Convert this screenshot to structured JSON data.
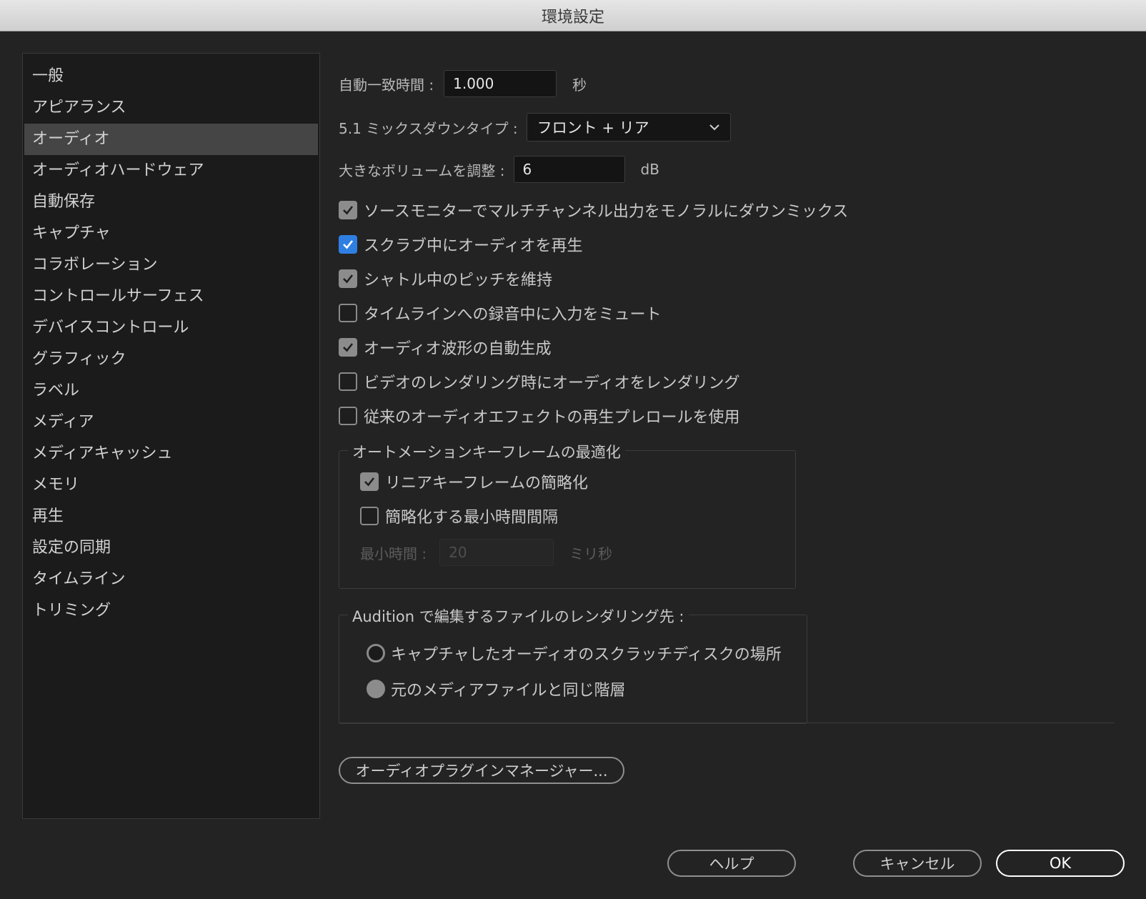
{
  "window": {
    "title": "環境設定"
  },
  "sidebar": {
    "items": [
      {
        "label": "一般"
      },
      {
        "label": "アピアランス"
      },
      {
        "label": "オーディオ",
        "selected": true
      },
      {
        "label": "オーディオハードウェア"
      },
      {
        "label": "自動保存"
      },
      {
        "label": "キャプチャ"
      },
      {
        "label": "コラボレーション"
      },
      {
        "label": "コントロールサーフェス"
      },
      {
        "label": "デバイスコントロール"
      },
      {
        "label": "グラフィック"
      },
      {
        "label": "ラベル"
      },
      {
        "label": "メディア"
      },
      {
        "label": "メディアキャッシュ"
      },
      {
        "label": "メモリ"
      },
      {
        "label": "再生"
      },
      {
        "label": "設定の同期"
      },
      {
        "label": "タイムライン"
      },
      {
        "label": "トリミング"
      }
    ]
  },
  "audio": {
    "auto_match": {
      "label": "自動一致時間 :",
      "value": "1.000",
      "unit": "秒"
    },
    "mixdown": {
      "label": "5.1 ミックスダウンタイプ :",
      "value": "フロント + リア"
    },
    "volume": {
      "label": "大きなボリュームを調整 :",
      "value": "6",
      "unit": "dB"
    },
    "checkboxes": [
      {
        "label": "ソースモニターでマルチチャンネル出力をモノラルにダウンミックス",
        "checked": true
      },
      {
        "label": "スクラブ中にオーディオを再生",
        "checked": true
      },
      {
        "label": "シャトル中のピッチを維持",
        "checked": true
      },
      {
        "label": "タイムラインへの録音中に入力をミュート",
        "checked": false
      },
      {
        "label": "オーディオ波形の自動生成",
        "checked": true
      },
      {
        "label": "ビデオのレンダリング時にオーディオをレンダリング",
        "checked": false
      },
      {
        "label": "従来のオーディオエフェクトの再生プレロールを使用",
        "checked": false
      }
    ],
    "automation": {
      "title": "オートメーションキーフレームの最適化",
      "linear": {
        "label": "リニアキーフレームの簡略化",
        "checked": true
      },
      "min_interval": {
        "label": "簡略化する最小時間間隔",
        "checked": false
      },
      "min_time": {
        "label": "最小時間 :",
        "value": "20",
        "unit": "ミリ秒"
      }
    },
    "audition": {
      "title": "Audition で編集するファイルのレンダリング先 :",
      "options": [
        {
          "label": "キャプチャしたオーディオのスクラッチディスクの場所",
          "selected": false
        },
        {
          "label": "元のメディアファイルと同じ階層",
          "selected": true
        }
      ]
    },
    "plugin_manager_label": "オーディオプラグインマネージャー..."
  },
  "footer": {
    "help": "ヘルプ",
    "cancel": "キャンセル",
    "ok": "OK"
  },
  "colors": {
    "accent": "#2f7fe3",
    "selection": "#454545",
    "background": "#232323"
  }
}
